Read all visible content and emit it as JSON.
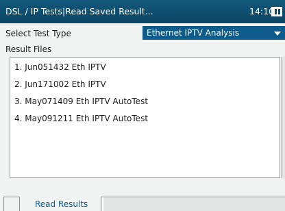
{
  "titlebar": {
    "title": "DSL / IP Tests|Read Saved Result...",
    "time": "14:10",
    "battery_icon": "battery-icon"
  },
  "select_test_type": {
    "label": "Select Test Type",
    "value": "Ethernet IPTV Analysis"
  },
  "result_files": {
    "label": "Result Files",
    "items": [
      "1. Jun051432 Eth IPTV",
      "2. Jun171002 Eth IPTV",
      "3. May071409 Eth IPTV AutoTest",
      "4. May091211 Eth IPTV AutoTest"
    ]
  },
  "tabs": {
    "read_results": "Read Results"
  },
  "colors": {
    "titlebar": "#0b4564",
    "selected": "#0d5b8a",
    "background": "#f1f2f2"
  }
}
